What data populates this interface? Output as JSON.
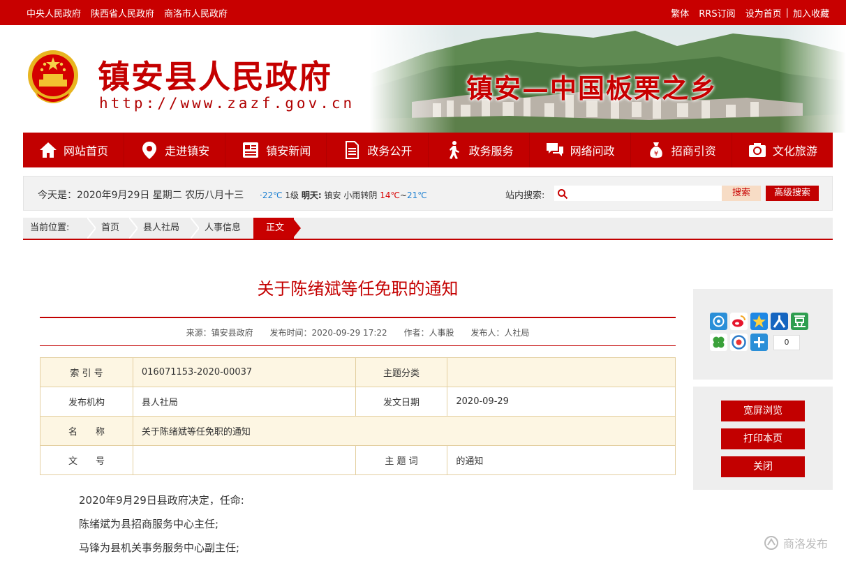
{
  "topbar": {
    "left_links": [
      "中央人民政府",
      "陕西省人民政府",
      "商洛市人民政府"
    ],
    "right_links": [
      "繁体",
      "RRS订阅",
      "设为首页",
      "加入收藏"
    ]
  },
  "header": {
    "site_title": "镇安县人民政府",
    "site_url": "http://www.zazf.gov.cn",
    "slogan": "镇安—中国板栗之乡"
  },
  "nav": {
    "items": [
      {
        "label": "网站首页",
        "icon": "home-icon"
      },
      {
        "label": "走进镇安",
        "icon": "location-pin-icon"
      },
      {
        "label": "镇安新闻",
        "icon": "newspaper-icon"
      },
      {
        "label": "政务公开",
        "icon": "document-icon"
      },
      {
        "label": "政务服务",
        "icon": "walking-person-icon"
      },
      {
        "label": "网络问政",
        "icon": "chat-bubbles-icon"
      },
      {
        "label": "招商引资",
        "icon": "money-bag-icon"
      },
      {
        "label": "文化旅游",
        "icon": "camera-icon"
      }
    ]
  },
  "infobar": {
    "date": "今天是：2020年9月29日  星期二  农历八月十三",
    "weather_temp_low": "22℃",
    "weather_wind": "1级",
    "weather_tomorrow_label": "明天:",
    "weather_place": "镇安",
    "weather_desc": "小雨转阴",
    "weather_high": "14℃",
    "weather_sep": "~",
    "weather_low": "21℃",
    "search_label": "站内搜索:",
    "search_placeholder": "",
    "search_button": "搜索",
    "advanced_button": "高级搜索"
  },
  "breadcrumb": {
    "label": "当前位置:",
    "items": [
      "首页",
      "县人社局",
      "人事信息"
    ],
    "current": "正文"
  },
  "article": {
    "title": "关于陈绪斌等任免职的通知",
    "meta_source": "来源：镇安县政府",
    "meta_time": "发布时间：2020-09-29 17:22",
    "meta_author": "作者：人事股",
    "meta_publisher": "发布人：人社局",
    "info_table": {
      "index_label": "索 引 号",
      "index_value": "016071153-2020-00037",
      "topic_label": "主题分类",
      "topic_value": "",
      "org_label": "发布机构",
      "org_value": "县人社局",
      "date_label": "发文日期",
      "date_value": "2020-09-29",
      "name_label": "名　　称",
      "name_value": "关于陈绪斌等任免职的通知",
      "docno_label": "文　　号",
      "docno_value": "",
      "keyword_label": "主 题 词",
      "keyword_value": "的通知"
    },
    "paragraphs": [
      "2020年9月29日县政府决定，任命:",
      "陈绪斌为县招商服务中心主任;",
      "马锋为县机关事务服务中心副主任;"
    ]
  },
  "sidebar": {
    "share_count": "0",
    "buttons": [
      "宽屏浏览",
      "打印本页",
      "关闭"
    ]
  },
  "watermark": "商洛发布",
  "colors": {
    "brand_red": "#c20000",
    "table_border": "#e3cfa0",
    "table_fill": "#fdf6e3"
  }
}
